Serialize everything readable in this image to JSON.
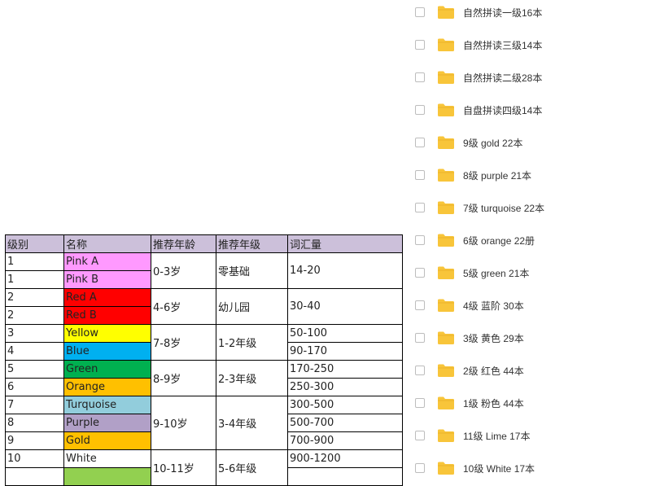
{
  "table": {
    "headers": [
      "级别",
      "名称",
      "推荐年龄",
      "推荐年级",
      "词汇量"
    ],
    "rows": [
      {
        "level": "1",
        "name": "Pink A",
        "color": "#ff99ff"
      },
      {
        "level": "1",
        "name": "Pink B",
        "color": "#ff99ff"
      },
      {
        "level": "2",
        "name": "Red A",
        "color": "#ff0000"
      },
      {
        "level": "2",
        "name": "Red B",
        "color": "#ff0000"
      },
      {
        "level": "3",
        "name": "Yellow",
        "color": "#ffff00"
      },
      {
        "level": "4",
        "name": "Blue",
        "color": "#00b0f0"
      },
      {
        "level": "5",
        "name": "Green",
        "color": "#00b050"
      },
      {
        "level": "6",
        "name": "Orange",
        "color": "#ffc000"
      },
      {
        "level": "7",
        "name": "Turquoise",
        "color": "#92cddc"
      },
      {
        "level": "8",
        "name": "Purple",
        "color": "#b1a0c7"
      },
      {
        "level": "9",
        "name": "Gold",
        "color": "#ffc000"
      },
      {
        "level": "10",
        "name": "White",
        "color": "#ffffff"
      },
      {
        "level": "",
        "name": "",
        "color": "#92d050"
      }
    ],
    "ages": [
      "0-3岁",
      "4-6岁",
      "7-8岁",
      "8-9岁",
      "9-10岁",
      "10-11岁"
    ],
    "grades": [
      "零基础",
      "幼儿园",
      "1-2年级",
      "2-3年级",
      "3-4年级",
      "5-6年级"
    ],
    "vocab": [
      "14-20",
      "30-40",
      "50-100",
      "90-170",
      "170-250",
      "250-300",
      "300-500",
      "500-700",
      "700-900",
      "900-1200",
      ""
    ]
  },
  "files": [
    "自然拼读一级16本",
    "自然拼读三级14本",
    "自然拼读二级28本",
    "自盘拼读四级14本",
    "9级 gold 22本",
    "8级 purple 21本",
    "7级 turquoise 22本",
    "6级 orange 22册",
    "5级 green 21本",
    "4级 蓝阶 30本",
    "3级 黄色 29本",
    "2级 红色 44本",
    "1级 粉色 44本",
    "11级 Lime 17本",
    "10级 White 17本"
  ],
  "colors": {
    "folder": "#f8c53a",
    "header_bg": "#ccc0da"
  }
}
